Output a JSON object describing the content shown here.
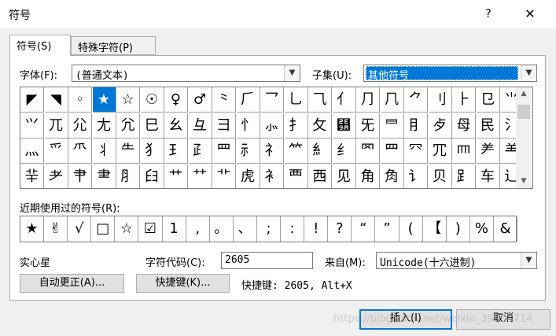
{
  "window": {
    "title": "符号",
    "help": "?",
    "close": "✕"
  },
  "tabs": [
    {
      "label": "符号(S)"
    },
    {
      "label": "特殊字符(P)"
    }
  ],
  "font": {
    "label": "字体(F):",
    "value": "(普通文本)"
  },
  "subset": {
    "label": "子集(U):",
    "value": "其他符号"
  },
  "symbols": [
    [
      "◤",
      "◥",
      "◦",
      "★",
      "☆",
      "☉",
      "♀",
      "♂",
      "⺀",
      "⺁",
      "⺂",
      "⺃",
      "⺄",
      "⺅",
      "⺆",
      "⺇",
      "⺈",
      "⺉",
      "⺊",
      "⺋",
      "⺌"
    ],
    [
      "⺍",
      "⺎",
      "⺏",
      "⺐",
      "⺑",
      "⺒",
      "⺓",
      "⺔",
      "⺕",
      "⺖",
      "⺗",
      "⺘",
      "⺙",
      "⺚",
      "⺛",
      "⺜",
      "⺝",
      "⺞",
      "⺟",
      "⺠",
      "⺡",
      "⺢"
    ],
    [
      "⺣",
      "⺤",
      "⺥",
      "⺦",
      "⺧",
      "⺨",
      "⺩",
      "⺪",
      "⺫",
      "⺬",
      "⺭",
      "⺮",
      "⺯",
      "⺰",
      "⺱",
      "⺲",
      "⺳",
      "⺴",
      "⺵",
      "⺶",
      "⺷"
    ],
    [
      "⺸",
      "⺹",
      "⺺",
      "⺻",
      "⺼",
      "⺽",
      "⺾",
      "⺿",
      "⻀",
      "⻁",
      "⻂",
      "⻃",
      "⻄",
      "⻅",
      "⻆",
      "⻇",
      "⻈",
      "⻉",
      "⻊",
      "⻋",
      "⻌"
    ]
  ],
  "selected": {
    "row": 0,
    "col": 3
  },
  "recent": {
    "label": "近期使用过的符号(R):",
    "items": [
      "★",
      "✌",
      "√",
      "□",
      "☆",
      "☑",
      "1",
      ",",
      "。",
      "、",
      ";",
      ":",
      "!",
      "?",
      "“",
      "”",
      "(",
      "【",
      ")",
      "%",
      "&"
    ]
  },
  "char_name": "实心星",
  "char_code": {
    "label": "字符代码(C):",
    "value": "2605"
  },
  "from": {
    "label": "来自(M):",
    "value": "Unicode(十六进制)"
  },
  "buttons": {
    "autocorrect": "自动更正(A)...",
    "shortcut_key": "快捷键(K)...",
    "insert": "插入(I)",
    "cancel": "取消"
  },
  "shortcut": {
    "text": "快捷键: 2605, Alt+X"
  },
  "watermark": "https://blog.csdn.net/weixin_39904714",
  "colors": {
    "accent": "#0078d7"
  }
}
